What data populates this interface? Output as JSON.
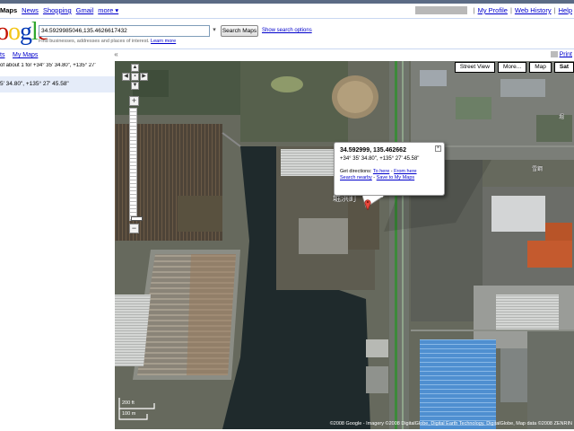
{
  "gbar": {
    "items": [
      {
        "label": "Maps",
        "current": true
      },
      {
        "label": "News",
        "current": false
      },
      {
        "label": "Shopping",
        "current": false
      },
      {
        "label": "Gmail",
        "current": false
      },
      {
        "label": "more ▾",
        "current": false
      }
    ],
    "right": {
      "my_profile": "My Profile",
      "web_history": "Web History",
      "help": "Help"
    }
  },
  "logo": {
    "text": "oogle",
    "colors": [
      "#0039b6",
      "#c41200",
      "#f3c518",
      "#0039b6",
      "#30a72f",
      "#c41200"
    ]
  },
  "search": {
    "value": "34.5929985046,135.4626617432",
    "button_label": "Search Maps",
    "options_link": "Show search options",
    "hint": "Find businesses, addresses and places of interest.",
    "hint_link": "Learn more"
  },
  "tabs": {
    "search_results": "ts",
    "my_maps": "My Maps",
    "collapse_icon": "«",
    "print": "Print"
  },
  "left_panel": {
    "result_summary": "of about 1 for +34° 35' 34.80\", +135° 27'",
    "result_item": "5' 34.80\", +135° 27' 45.58\""
  },
  "map": {
    "type_buttons": [
      "Street View",
      "More...",
      "Map",
      "Sat"
    ],
    "info_window": {
      "title": "34.592999, 135.462662",
      "dms": "+34° 35' 34.80\", +135° 27' 45.58\"",
      "directions_prefix": "Get directions:",
      "to_here": "To here",
      "from_here": "From here",
      "search_nearby": "Search nearby",
      "save": "Save to My Maps",
      "close_icon": "×"
    },
    "scale": {
      "feet": "200 ft",
      "meters": "100 m"
    },
    "copyright": "©2008 Google - Imagery ©2008 DigitalGlobe, Digital Earth Technology, DigitalGlobe, Map data ©2008 ZENRIN",
    "labels": [
      "堀浜町",
      "堀",
      "雪鋼"
    ]
  }
}
